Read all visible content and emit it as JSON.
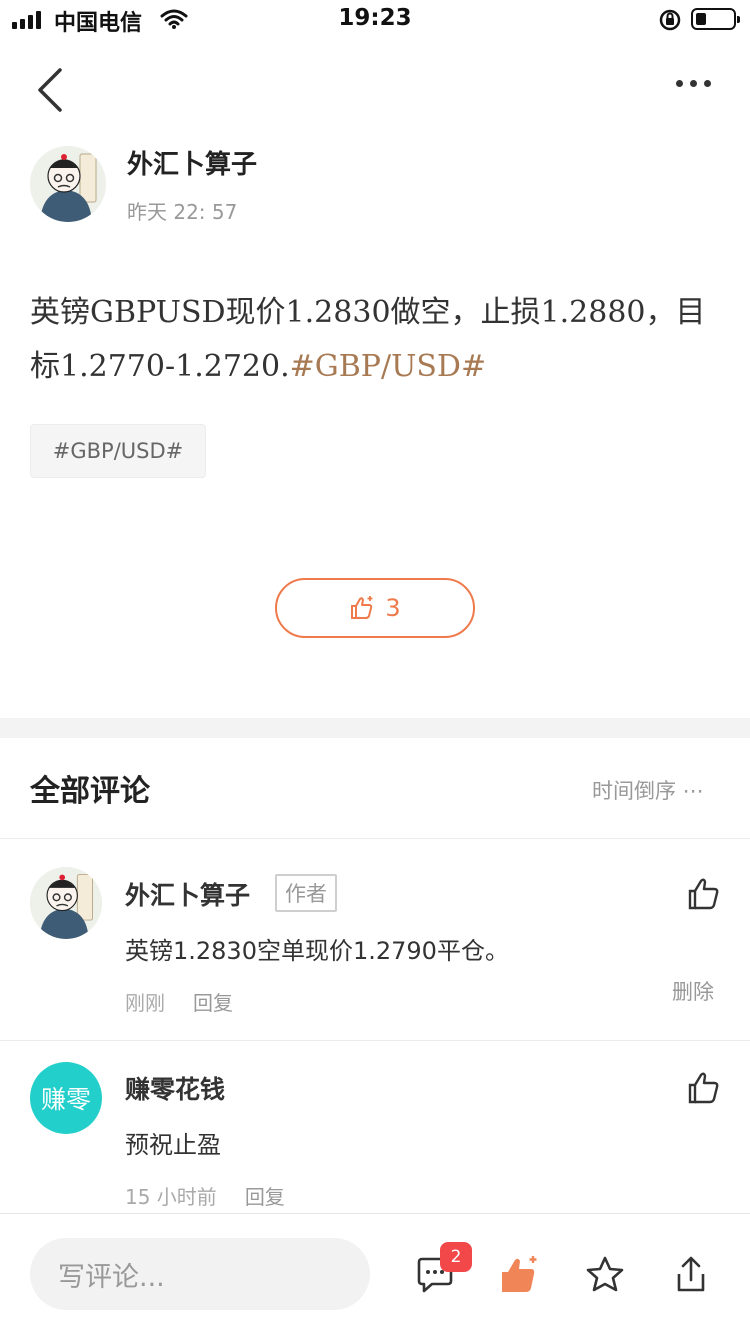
{
  "status_bar": {
    "carrier": "中国电信",
    "time": "19:23",
    "battery_level": 0.2
  },
  "post": {
    "author": "外汇卜算子",
    "time": "昨天 22: 57",
    "body_text": "英镑GBPUSD现价1.2830做空，止损1.2880，目标1.2770-1.2720.",
    "body_hashtag": "#GBP/USD#",
    "tag": "#GBP/USD#",
    "like_count": "3"
  },
  "comments_section": {
    "title": "全部评论",
    "sort_label": "时间倒序 ⋯",
    "items": [
      {
        "name": "外汇卜算子",
        "badge": "作者",
        "text": "英镑1.2830空单现价1.2790平仓。",
        "time": "刚刚",
        "reply": "回复",
        "delete": "删除"
      },
      {
        "name": "赚零花钱",
        "avatar_text": "赚零",
        "text": "预祝止盈",
        "time": "15 小时前",
        "reply": "回复"
      }
    ]
  },
  "bottom_bar": {
    "input_placeholder": "写评论...",
    "comment_badge": "2"
  },
  "colors": {
    "accent": "#ef7a4c",
    "hashtag": "#a87a54",
    "avatar_teal": "#22cfcb",
    "badge_red": "#f2484a"
  }
}
